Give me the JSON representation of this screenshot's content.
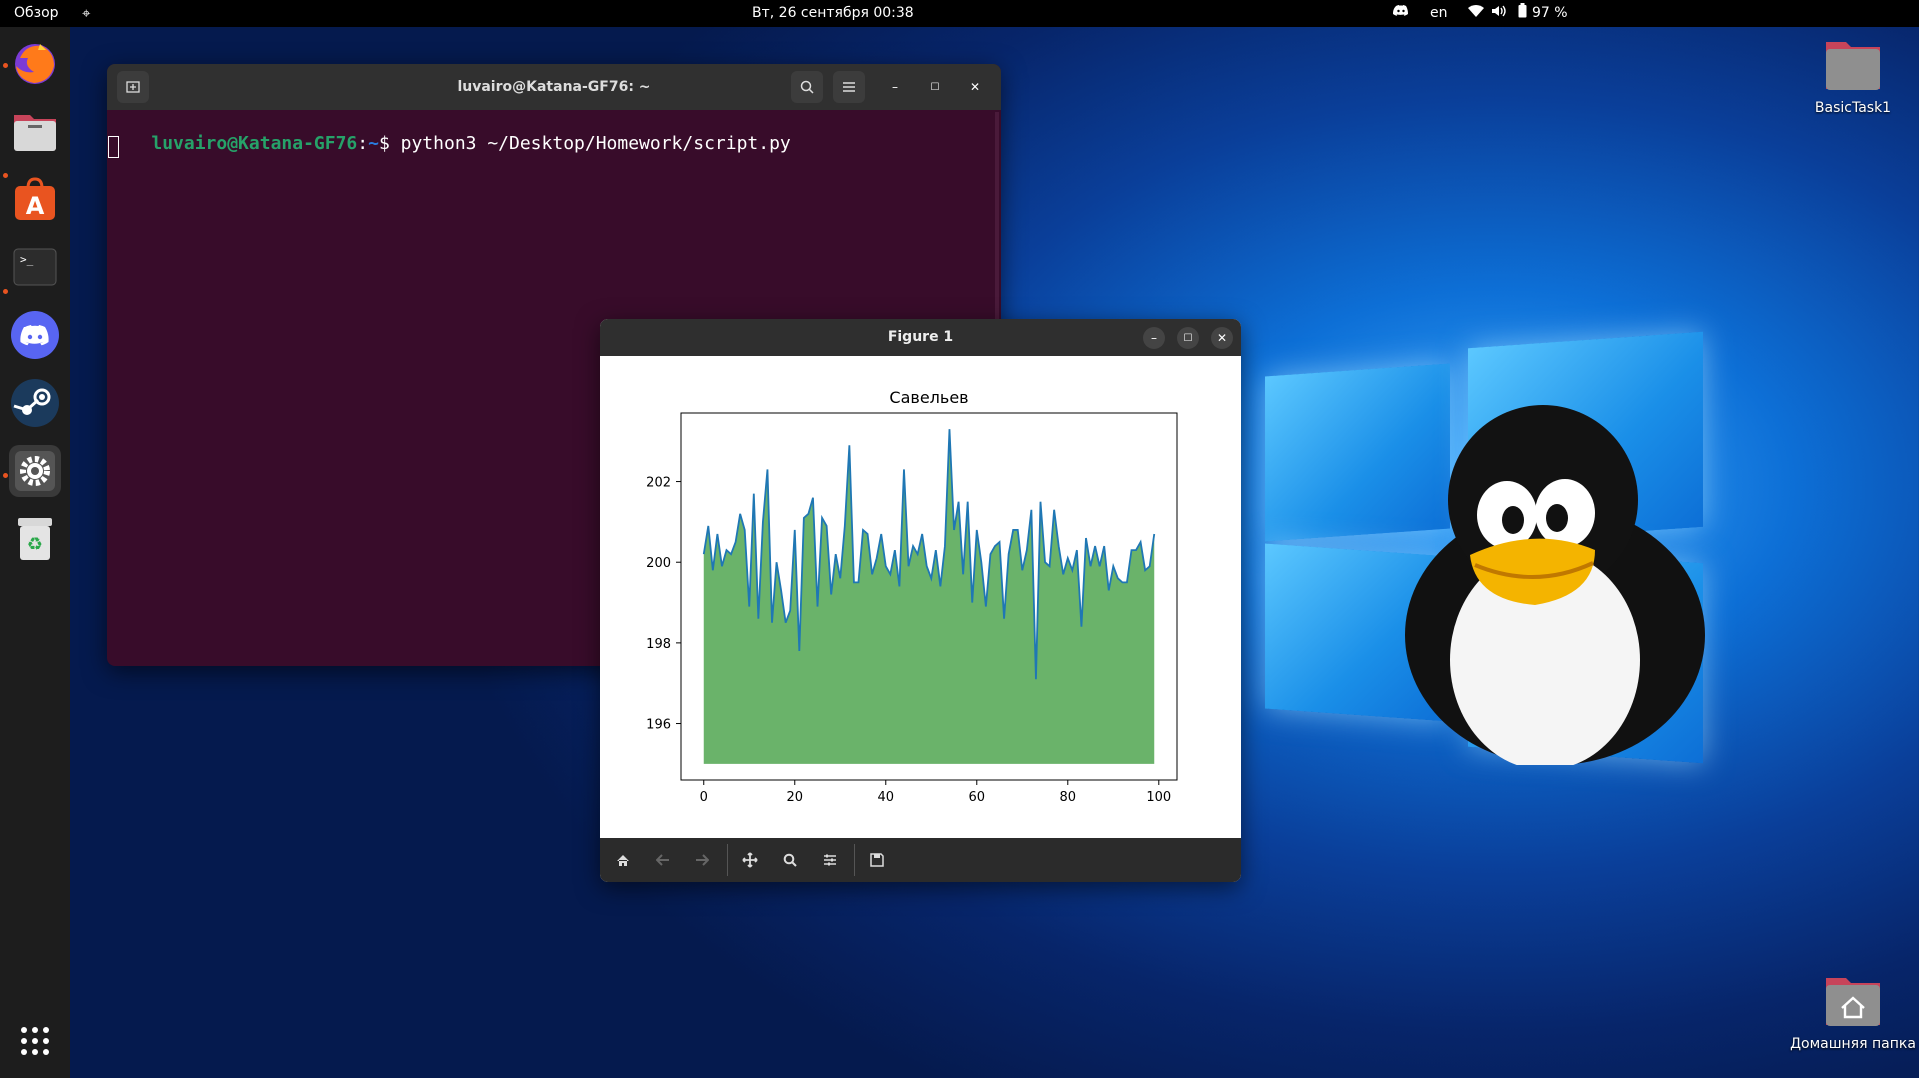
{
  "topbar": {
    "activities": "Обзор",
    "datetime": "Вт, 26 сентября  00:38",
    "language": "en",
    "battery": "97 %"
  },
  "dock": {
    "apps": [
      "firefox-icon",
      "files-icon",
      "software-icon",
      "terminal-icon",
      "discord-icon",
      "steam-icon",
      "settings-icon",
      "trash-icon"
    ],
    "grid_icon": "app-grid-icon"
  },
  "desktop": {
    "icons": [
      {
        "label": "BasicTask1"
      },
      {
        "label": "Домашняя папка"
      }
    ]
  },
  "terminal": {
    "title": "luvairo@Katana-GF76: ~",
    "prompt_user": "luvairo@Katana-GF76",
    "prompt_sep": ":",
    "prompt_path": "~",
    "prompt_sym": "$",
    "command": " python3 ~/Desktop/Homework/script.py"
  },
  "figure": {
    "title": "Figure 1"
  },
  "chart_data": {
    "type": "area",
    "title": "Савельев",
    "xlabel": "",
    "ylabel": "",
    "xlim": [
      -5,
      104
    ],
    "ylim": [
      194.6,
      203.7
    ],
    "xticks": [
      0,
      20,
      40,
      60,
      80,
      100
    ],
    "yticks": [
      196,
      198,
      200,
      202
    ],
    "baseline": 195,
    "fill_color": "#6ab36a",
    "line_color": "#1f77b4",
    "x": [
      0,
      1,
      2,
      3,
      4,
      5,
      6,
      7,
      8,
      9,
      10,
      11,
      12,
      13,
      14,
      15,
      16,
      17,
      18,
      19,
      20,
      21,
      22,
      23,
      24,
      25,
      26,
      27,
      28,
      29,
      30,
      31,
      32,
      33,
      34,
      35,
      36,
      37,
      38,
      39,
      40,
      41,
      42,
      43,
      44,
      45,
      46,
      47,
      48,
      49,
      50,
      51,
      52,
      53,
      54,
      55,
      56,
      57,
      58,
      59,
      60,
      61,
      62,
      63,
      64,
      65,
      66,
      67,
      68,
      69,
      70,
      71,
      72,
      73,
      74,
      75,
      76,
      77,
      78,
      79,
      80,
      81,
      82,
      83,
      84,
      85,
      86,
      87,
      88,
      89,
      90,
      91,
      92,
      93,
      94,
      95,
      96,
      97,
      98,
      99
    ],
    "values": [
      200.2,
      200.9,
      199.8,
      200.7,
      199.9,
      200.3,
      200.2,
      200.5,
      201.2,
      200.8,
      198.9,
      201.7,
      198.6,
      201.0,
      202.3,
      198.5,
      200.0,
      199.3,
      198.5,
      198.8,
      200.8,
      197.8,
      201.1,
      201.2,
      201.6,
      198.9,
      201.1,
      200.9,
      199.2,
      200.2,
      199.6,
      200.9,
      202.9,
      199.5,
      199.5,
      200.8,
      200.7,
      199.7,
      200.1,
      200.7,
      199.9,
      199.7,
      200.3,
      199.4,
      202.3,
      199.9,
      200.4,
      200.2,
      200.7,
      199.9,
      199.6,
      200.3,
      199.4,
      200.4,
      203.3,
      200.8,
      201.5,
      199.7,
      201.5,
      199.0,
      200.8,
      200.0,
      198.9,
      200.2,
      200.4,
      200.5,
      198.6,
      200.2,
      200.8,
      200.8,
      199.8,
      200.3,
      201.3,
      197.1,
      201.5,
      200.0,
      199.9,
      201.3,
      200.4,
      199.7,
      200.1,
      199.8,
      200.3,
      198.4,
      200.6,
      199.9,
      200.4,
      199.9,
      200.4,
      199.3,
      199.9,
      199.6,
      199.5,
      199.5,
      200.3,
      200.3,
      200.5,
      199.8,
      199.9,
      200.7
    ]
  }
}
